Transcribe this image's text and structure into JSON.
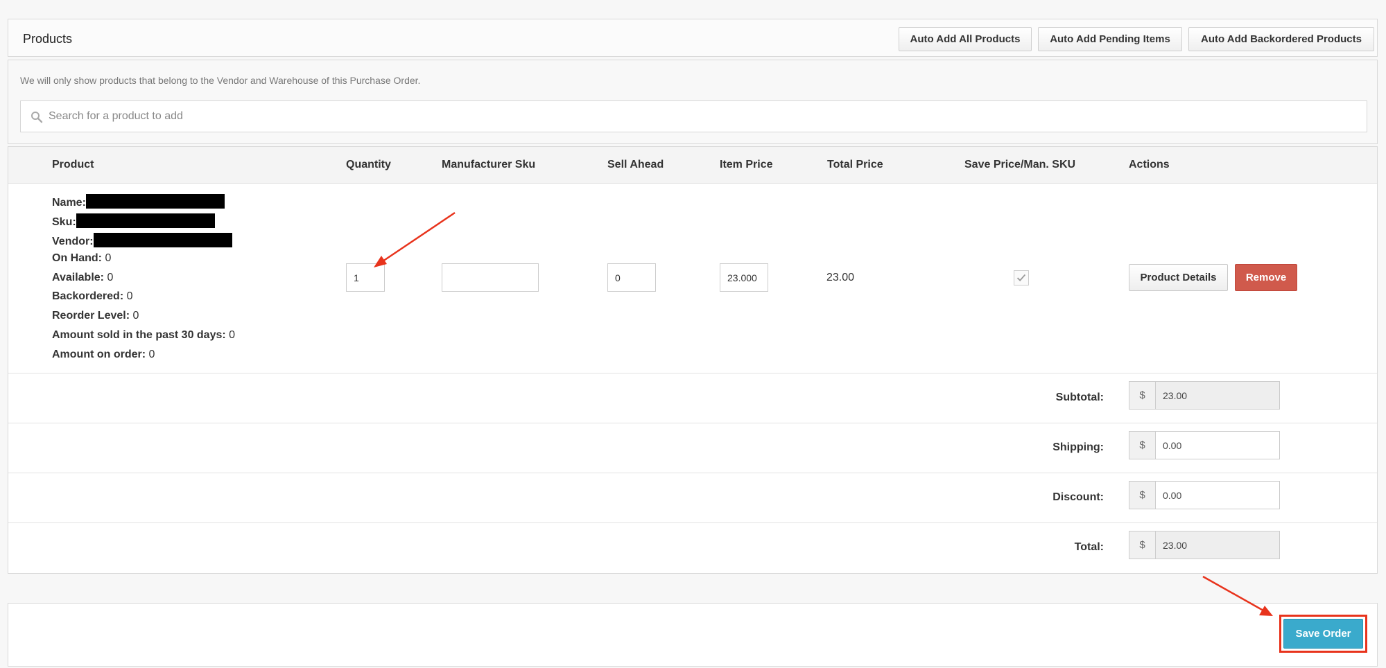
{
  "panel": {
    "title": "Products",
    "buttons": {
      "auto_add_all": "Auto Add All Products",
      "auto_add_pending": "Auto Add Pending Items",
      "auto_add_backordered": "Auto Add Backordered Products"
    }
  },
  "notice": "We will only show products that belong to the Vendor and Warehouse of this Purchase Order.",
  "search": {
    "placeholder": "Search for a product to add",
    "value": ""
  },
  "table": {
    "headers": {
      "product": "Product",
      "quantity": "Quantity",
      "manufacturer_sku": "Manufacturer Sku",
      "sell_ahead": "Sell Ahead",
      "item_price": "Item Price",
      "total_price": "Total Price",
      "save_price": "Save Price/Man. SKU",
      "actions": "Actions"
    },
    "row": {
      "labels": {
        "name": "Name:",
        "sku": "Sku:",
        "vendor": "Vendor:",
        "on_hand": "On Hand:",
        "available": "Available:",
        "backordered": "Backordered:",
        "reorder_level": "Reorder Level:",
        "sold_30": "Amount sold in the past 30 days:",
        "on_order": "Amount on order:"
      },
      "values": {
        "on_hand": "0",
        "available": "0",
        "backordered": "0",
        "reorder_level": "0",
        "sold_30": "0",
        "on_order": "0"
      },
      "quantity": "1",
      "manufacturer_sku": "",
      "sell_ahead": "0",
      "item_price": "23.000",
      "total_price": "23.00",
      "save_price_checked": true,
      "actions": {
        "details": "Product Details",
        "remove": "Remove"
      }
    }
  },
  "summary": {
    "currency": "$",
    "subtotal": {
      "label": "Subtotal:",
      "value": "23.00"
    },
    "shipping": {
      "label": "Shipping:",
      "value": "0.00"
    },
    "discount": {
      "label": "Discount:",
      "value": "0.00"
    },
    "total": {
      "label": "Total:",
      "value": "23.00"
    }
  },
  "footer": {
    "save_label": "Save Order"
  },
  "colors": {
    "remove": "#d05a4c",
    "save": "#3aaacc",
    "annotation": "#e8331c"
  },
  "checkmark_icon": "✓"
}
